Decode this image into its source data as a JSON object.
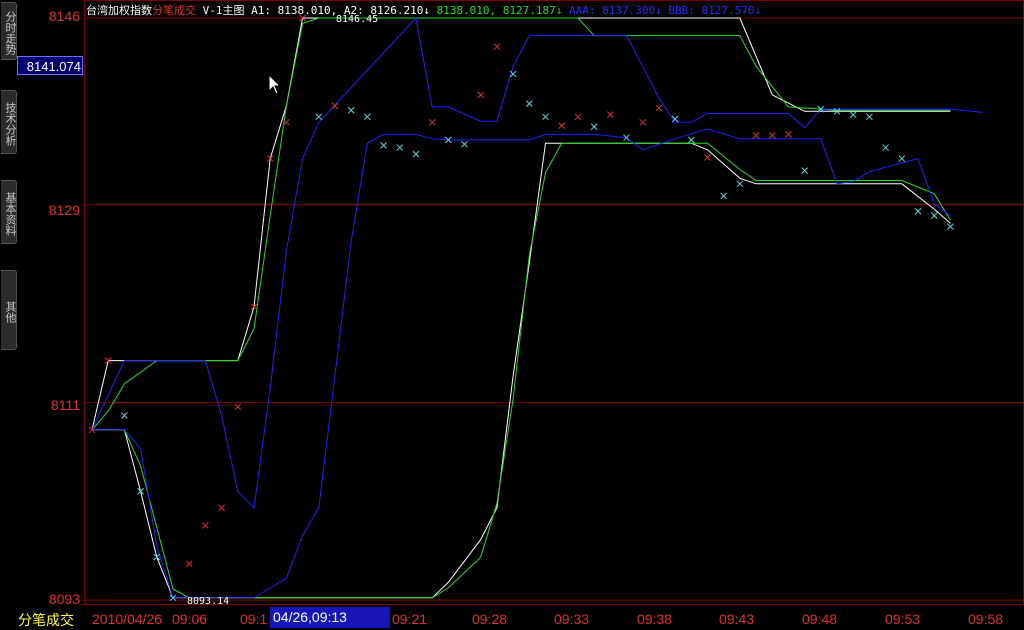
{
  "sidebar": {
    "tabs": [
      {
        "label": "分时走势"
      },
      {
        "label": "技术分析"
      },
      {
        "label": "基本资料"
      },
      {
        "label": "其他"
      }
    ]
  },
  "header": {
    "index_name": "台湾加权指数",
    "chart_mode": "分笔成交",
    "indicator_name": "V-1主图",
    "a_values": "A1: 8138.010, A2: 8126.210↓",
    "green_values": "8138.010, 8127.187↓",
    "aaa_value": "AAA: 8137.300↓",
    "bbb_value": "BBB: 8127.570↓"
  },
  "axis": {
    "y_labels": [
      "8146",
      "8129",
      "8111",
      "8093"
    ],
    "current_price": "8141.074",
    "high_label": "8146.45",
    "low_label": "8093.14"
  },
  "bottom": {
    "title": "分笔成交",
    "date": "2010/04/26",
    "cursor_time": "04/26,09:13",
    "times": [
      "09:06",
      "09:1",
      "09:21",
      "09:28",
      "09:33",
      "09:38",
      "09:43",
      "09:48",
      "09:53",
      "09:58"
    ]
  },
  "colors": {
    "up": "#e0302a",
    "down": "#5ad8e0",
    "white_line": "#ffffff",
    "green_line": "#22dd22",
    "blue_line": "#2020ff",
    "grid": "#7a0000"
  },
  "chart_data": {
    "type": "line",
    "ylim": [
      8093,
      8146
    ],
    "x": [
      0,
      1,
      2,
      3,
      4,
      5,
      6,
      7,
      8,
      9,
      10,
      11,
      12,
      13,
      14,
      15,
      16,
      17,
      18,
      19,
      20,
      21,
      22,
      23,
      24,
      25,
      26,
      27,
      28,
      29,
      30,
      31,
      32,
      33,
      34,
      35,
      36,
      37,
      38,
      39,
      40,
      41,
      42,
      43,
      44,
      45,
      46,
      47,
      48,
      49,
      50,
      51,
      52,
      53,
      54,
      55,
      56
    ],
    "trades": [
      {
        "x": 0,
        "y": 8108.5,
        "dir": "up"
      },
      {
        "x": 1,
        "y": 8114.8,
        "dir": "up"
      },
      {
        "x": 2,
        "y": 8109.8,
        "dir": "down"
      },
      {
        "x": 3,
        "y": 8102.9,
        "dir": "down"
      },
      {
        "x": 4,
        "y": 8096.9,
        "dir": "down"
      },
      {
        "x": 5,
        "y": 8093.2,
        "dir": "down"
      },
      {
        "x": 6,
        "y": 8096.3,
        "dir": "up"
      },
      {
        "x": 7,
        "y": 8099.8,
        "dir": "up"
      },
      {
        "x": 8,
        "y": 8101.4,
        "dir": "up"
      },
      {
        "x": 9,
        "y": 8110.6,
        "dir": "up"
      },
      {
        "x": 10,
        "y": 8119.7,
        "dir": "up"
      },
      {
        "x": 11,
        "y": 8133.2,
        "dir": "up"
      },
      {
        "x": 12,
        "y": 8136.5,
        "dir": "up"
      },
      {
        "x": 13,
        "y": 8146.0,
        "dir": "up"
      },
      {
        "x": 14,
        "y": 8137.0,
        "dir": "down"
      },
      {
        "x": 15,
        "y": 8138.0,
        "dir": "up"
      },
      {
        "x": 16,
        "y": 8137.6,
        "dir": "down"
      },
      {
        "x": 17,
        "y": 8137.0,
        "dir": "down"
      },
      {
        "x": 18,
        "y": 8134.4,
        "dir": "down"
      },
      {
        "x": 19,
        "y": 8134.2,
        "dir": "down"
      },
      {
        "x": 20,
        "y": 8133.6,
        "dir": "down"
      },
      {
        "x": 21,
        "y": 8136.5,
        "dir": "up"
      },
      {
        "x": 22,
        "y": 8134.9,
        "dir": "down"
      },
      {
        "x": 23,
        "y": 8134.5,
        "dir": "down"
      },
      {
        "x": 24,
        "y": 8139.0,
        "dir": "up"
      },
      {
        "x": 25,
        "y": 8143.4,
        "dir": "up"
      },
      {
        "x": 26,
        "y": 8140.9,
        "dir": "down"
      },
      {
        "x": 27,
        "y": 8138.2,
        "dir": "down"
      },
      {
        "x": 28,
        "y": 8137.0,
        "dir": "down"
      },
      {
        "x": 29,
        "y": 8136.2,
        "dir": "up"
      },
      {
        "x": 30,
        "y": 8137.0,
        "dir": "up"
      },
      {
        "x": 31,
        "y": 8136.1,
        "dir": "down"
      },
      {
        "x": 32,
        "y": 8137.2,
        "dir": "up"
      },
      {
        "x": 33,
        "y": 8135.1,
        "dir": "down"
      },
      {
        "x": 34,
        "y": 8136.5,
        "dir": "up"
      },
      {
        "x": 35,
        "y": 8137.8,
        "dir": "up"
      },
      {
        "x": 36,
        "y": 8136.8,
        "dir": "down"
      },
      {
        "x": 37,
        "y": 8134.9,
        "dir": "down"
      },
      {
        "x": 38,
        "y": 8133.3,
        "dir": "up"
      },
      {
        "x": 39,
        "y": 8129.8,
        "dir": "down"
      },
      {
        "x": 40,
        "y": 8130.9,
        "dir": "down"
      },
      {
        "x": 41,
        "y": 8135.3,
        "dir": "up"
      },
      {
        "x": 42,
        "y": 8135.3,
        "dir": "up"
      },
      {
        "x": 43,
        "y": 8135.4,
        "dir": "up"
      },
      {
        "x": 44,
        "y": 8132.1,
        "dir": "down"
      },
      {
        "x": 45,
        "y": 8137.7,
        "dir": "down"
      },
      {
        "x": 46,
        "y": 8137.5,
        "dir": "down"
      },
      {
        "x": 47,
        "y": 8137.2,
        "dir": "down"
      },
      {
        "x": 48,
        "y": 8137.0,
        "dir": "down"
      },
      {
        "x": 49,
        "y": 8134.2,
        "dir": "down"
      },
      {
        "x": 50,
        "y": 8133.2,
        "dir": "down"
      },
      {
        "x": 51,
        "y": 8128.4,
        "dir": "down"
      },
      {
        "x": 52,
        "y": 8128.0,
        "dir": "down"
      },
      {
        "x": 53,
        "y": 8127.0,
        "dir": "down"
      }
    ],
    "series": [
      {
        "color": "#ffffff",
        "points": [
          [
            0,
            8108.5
          ],
          [
            1,
            8114.8
          ],
          [
            4,
            8114.8
          ],
          [
            6,
            8114.8
          ],
          [
            9,
            8114.8
          ],
          [
            10,
            8119.7
          ],
          [
            11,
            8133.2
          ],
          [
            12,
            8138
          ],
          [
            13,
            8146
          ],
          [
            20,
            8146
          ],
          [
            27,
            8146
          ],
          [
            29,
            8146
          ],
          [
            31,
            8146
          ],
          [
            33,
            8146
          ],
          [
            40,
            8146
          ],
          [
            42,
            8139
          ],
          [
            44,
            8137.5
          ],
          [
            46,
            8137.5
          ],
          [
            51,
            8137.5
          ],
          [
            53,
            8137.5
          ]
        ]
      },
      {
        "color": "#22dd22",
        "points": [
          [
            0,
            8108.5
          ],
          [
            1,
            8110.2
          ],
          [
            2,
            8112.7
          ],
          [
            4,
            8114.8
          ],
          [
            9,
            8114.8
          ],
          [
            10,
            8117.7
          ],
          [
            11,
            8128.0
          ],
          [
            12,
            8138.0
          ],
          [
            13,
            8145.5
          ],
          [
            14,
            8146.0
          ],
          [
            20,
            8146.0
          ],
          [
            27,
            8146.0
          ],
          [
            30,
            8146.0
          ],
          [
            31,
            8144.4
          ],
          [
            33,
            8144.4
          ],
          [
            40,
            8144.4
          ],
          [
            41,
            8141.6
          ],
          [
            43,
            8137.9
          ],
          [
            46,
            8137.6
          ],
          [
            53,
            8137.6
          ]
        ]
      },
      {
        "color": "#2020ff",
        "points": [
          [
            0,
            8108.5
          ],
          [
            2,
            8114.8
          ],
          [
            7,
            8114.8
          ],
          [
            8,
            8109.8
          ],
          [
            9,
            8102.9
          ],
          [
            10,
            8101.4
          ],
          [
            11,
            8112.3
          ],
          [
            12,
            8124.8
          ],
          [
            13,
            8133.2
          ],
          [
            14,
            8136.5
          ],
          [
            20,
            8146.0
          ],
          [
            21,
            8137.9
          ],
          [
            22,
            8137.9
          ],
          [
            24,
            8136.6
          ],
          [
            25,
            8136.6
          ],
          [
            26,
            8141.6
          ],
          [
            27,
            8144.4
          ],
          [
            33,
            8144.4
          ],
          [
            34,
            8141.6
          ],
          [
            35,
            8138.7
          ],
          [
            36,
            8136.5
          ],
          [
            37,
            8136.5
          ],
          [
            38,
            8137.3
          ],
          [
            42,
            8137.3
          ],
          [
            43,
            8137.3
          ],
          [
            44,
            8136.0
          ],
          [
            45,
            8137.7
          ],
          [
            53,
            8137.7
          ],
          [
            55,
            8137.4
          ]
        ]
      }
    ],
    "series_lower": [
      {
        "color": "#ffffff",
        "points": [
          [
            0,
            8108.5
          ],
          [
            2,
            8108.5
          ],
          [
            3,
            8102.9
          ],
          [
            4,
            8096.9
          ],
          [
            5,
            8093.2
          ],
          [
            10,
            8093.2
          ],
          [
            15,
            8093.2
          ],
          [
            21,
            8093.2
          ],
          [
            22,
            8094.6
          ],
          [
            24,
            8098.5
          ],
          [
            25,
            8101.4
          ],
          [
            26,
            8113.4
          ],
          [
            27,
            8123.7
          ],
          [
            28,
            8134.6
          ],
          [
            29,
            8134.6
          ],
          [
            35,
            8134.6
          ],
          [
            37,
            8134.6
          ],
          [
            38,
            8134.0
          ],
          [
            40,
            8131.4
          ],
          [
            41,
            8130.9
          ],
          [
            45,
            8130.9
          ],
          [
            50,
            8130.9
          ],
          [
            52,
            8128.6
          ],
          [
            53,
            8127.3
          ]
        ]
      },
      {
        "color": "#22dd22",
        "points": [
          [
            0,
            8108.5
          ],
          [
            2,
            8108.5
          ],
          [
            3,
            8105.2
          ],
          [
            4,
            8099.6
          ],
          [
            5,
            8094.0
          ],
          [
            6,
            8093.2
          ],
          [
            21,
            8093.2
          ],
          [
            22,
            8094.1
          ],
          [
            24,
            8096.9
          ],
          [
            25,
            8101.8
          ],
          [
            26,
            8111.3
          ],
          [
            27,
            8124.4
          ],
          [
            28,
            8131.9
          ],
          [
            29,
            8134.6
          ],
          [
            35,
            8134.6
          ],
          [
            38,
            8134.6
          ],
          [
            40,
            8132.2
          ],
          [
            41,
            8131.2
          ],
          [
            45,
            8131.2
          ],
          [
            50,
            8131.2
          ],
          [
            52,
            8130.0
          ],
          [
            53,
            8127.6
          ]
        ]
      },
      {
        "color": "#2020ff",
        "points": [
          [
            0,
            8108.5
          ],
          [
            2,
            8108.5
          ],
          [
            3,
            8106.8
          ],
          [
            4,
            8097.9
          ],
          [
            5,
            8093.2
          ],
          [
            10,
            8093.2
          ],
          [
            12,
            8095.0
          ],
          [
            13,
            8098.9
          ],
          [
            14,
            8101.4
          ],
          [
            15,
            8113.4
          ],
          [
            16,
            8125.6
          ],
          [
            17,
            8134.6
          ],
          [
            18,
            8135.4
          ],
          [
            20,
            8135.4
          ],
          [
            21,
            8135.0
          ],
          [
            22,
            8134.9
          ],
          [
            24,
            8134.9
          ],
          [
            27,
            8134.9
          ],
          [
            28,
            8135.4
          ],
          [
            31,
            8135.4
          ],
          [
            33,
            8135.1
          ],
          [
            34,
            8134.0
          ],
          [
            36,
            8135.0
          ],
          [
            38,
            8135.9
          ],
          [
            40,
            8135.0
          ],
          [
            41,
            8135.0
          ],
          [
            45,
            8135.0
          ],
          [
            46,
            8130.9
          ],
          [
            47,
            8131.1
          ],
          [
            48,
            8132.0
          ],
          [
            51,
            8133.2
          ],
          [
            52,
            8129.1
          ],
          [
            53,
            8128.0
          ]
        ]
      }
    ]
  }
}
